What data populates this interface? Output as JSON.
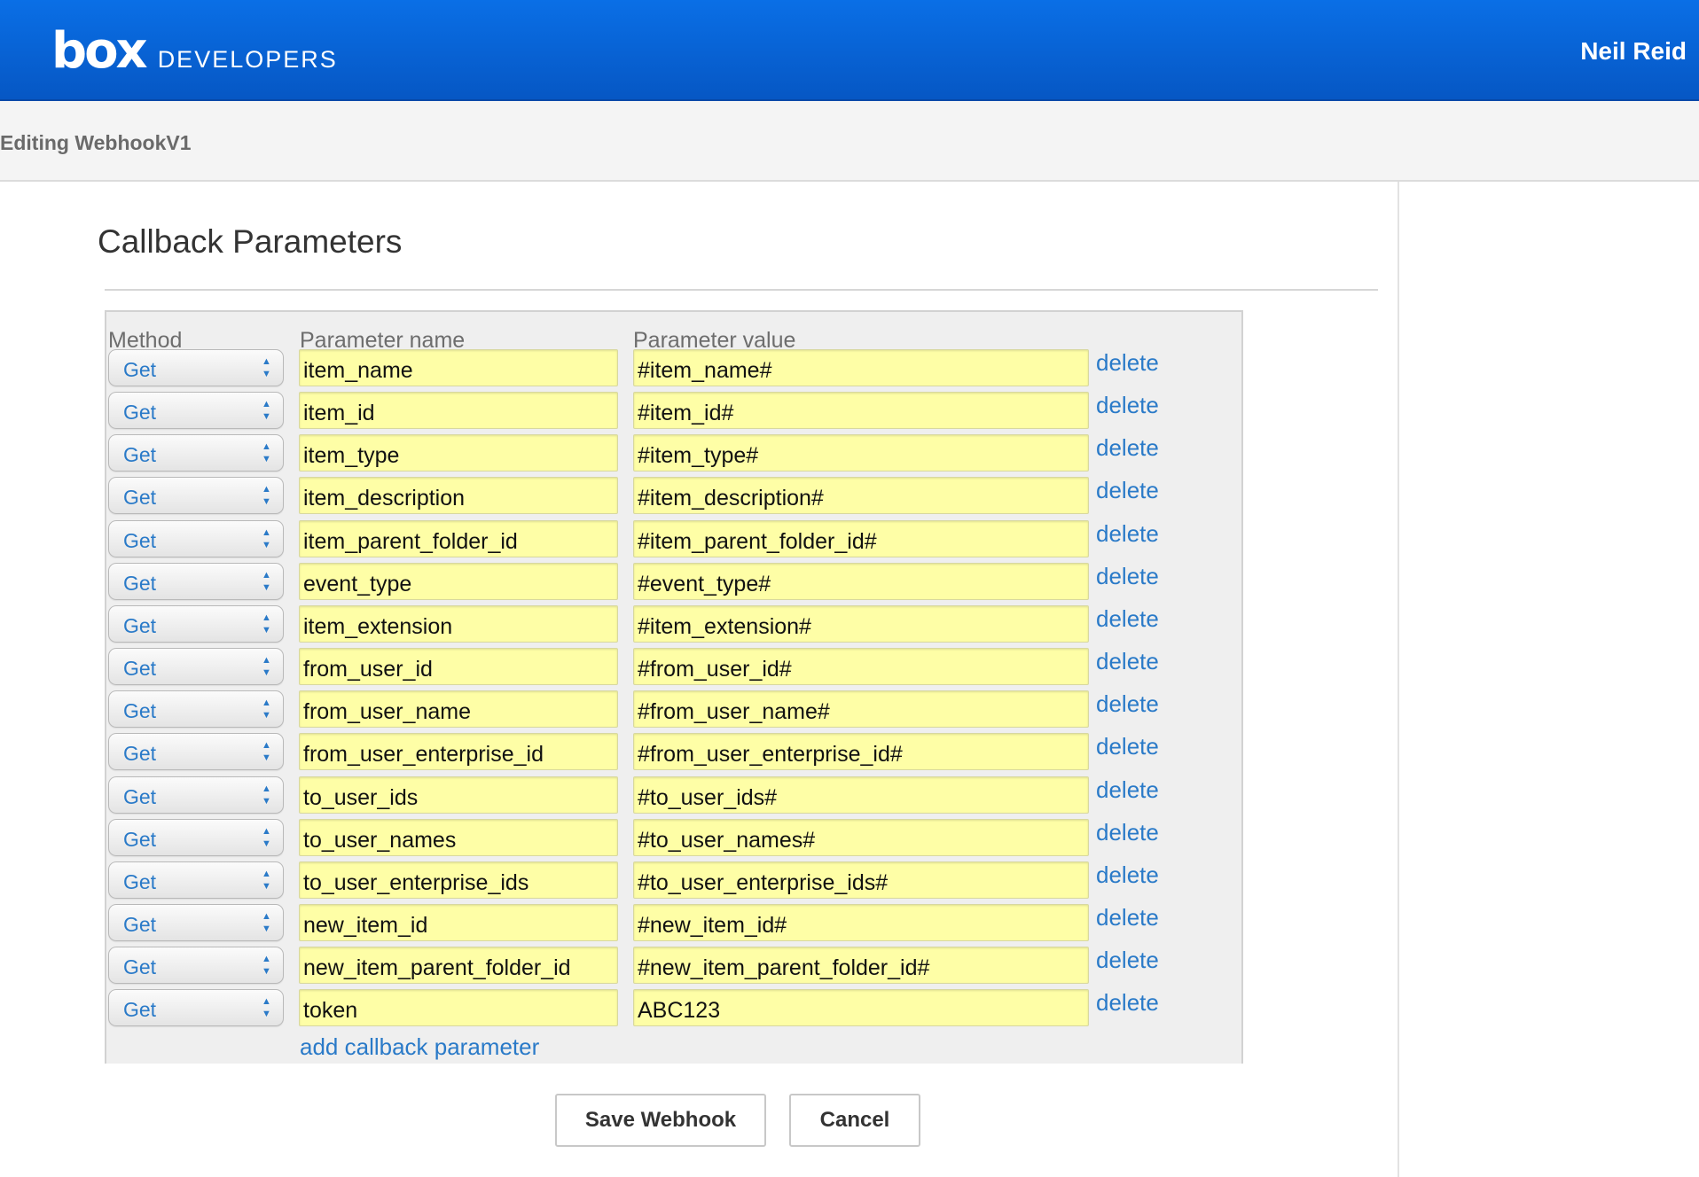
{
  "header": {
    "logo_mark": "box",
    "logo_text": "DEVELOPERS",
    "user_name": "Neil Reid",
    "colors": {
      "header_bg": "#0a6fe6"
    }
  },
  "subbar": {
    "title": "Editing WebhookV1"
  },
  "section": {
    "title": "Callback Parameters"
  },
  "table": {
    "headers": {
      "method": "Method",
      "name": "Parameter name",
      "value": "Parameter value"
    },
    "rows": [
      {
        "method": "Get",
        "name": "item_name",
        "value": "#item_name#",
        "action": "delete"
      },
      {
        "method": "Get",
        "name": "item_id",
        "value": "#item_id#",
        "action": "delete"
      },
      {
        "method": "Get",
        "name": "item_type",
        "value": "#item_type#",
        "action": "delete"
      },
      {
        "method": "Get",
        "name": "item_description",
        "value": "#item_description#",
        "action": "delete"
      },
      {
        "method": "Get",
        "name": "item_parent_folder_id",
        "value": "#item_parent_folder_id#",
        "action": "delete"
      },
      {
        "method": "Get",
        "name": "event_type",
        "value": "#event_type#",
        "action": "delete"
      },
      {
        "method": "Get",
        "name": "item_extension",
        "value": "#item_extension#",
        "action": "delete"
      },
      {
        "method": "Get",
        "name": "from_user_id",
        "value": "#from_user_id#",
        "action": "delete"
      },
      {
        "method": "Get",
        "name": "from_user_name",
        "value": "#from_user_name#",
        "action": "delete"
      },
      {
        "method": "Get",
        "name": "from_user_enterprise_id",
        "value": "#from_user_enterprise_id#",
        "action": "delete"
      },
      {
        "method": "Get",
        "name": "to_user_ids",
        "value": "#to_user_ids#",
        "action": "delete"
      },
      {
        "method": "Get",
        "name": "to_user_names",
        "value": "#to_user_names#",
        "action": "delete"
      },
      {
        "method": "Get",
        "name": "to_user_enterprise_ids",
        "value": "#to_user_enterprise_ids#",
        "action": "delete"
      },
      {
        "method": "Get",
        "name": "new_item_id",
        "value": "#new_item_id#",
        "action": "delete"
      },
      {
        "method": "Get",
        "name": "new_item_parent_folder_id",
        "value": "#new_item_parent_folder_id#",
        "action": "delete"
      },
      {
        "method": "Get",
        "name": "token",
        "value": "ABC123",
        "action": "delete"
      }
    ],
    "add_link": "add callback parameter"
  },
  "buttons": {
    "save": "Save Webhook",
    "cancel": "Cancel"
  }
}
